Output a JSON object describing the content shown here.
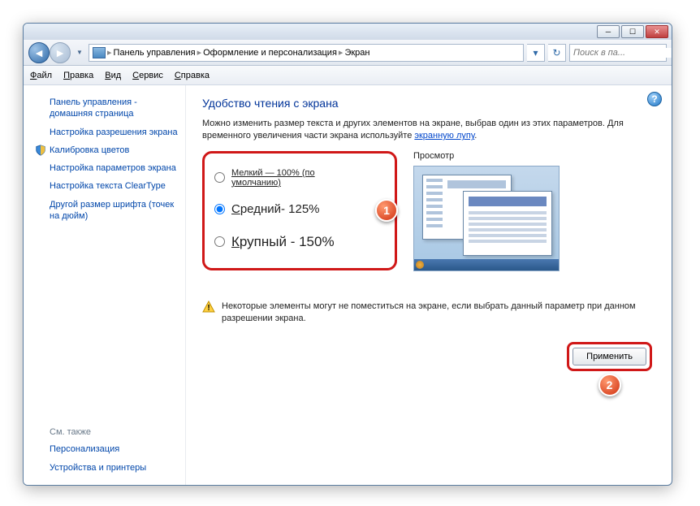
{
  "titlebar": {
    "min": "─",
    "max": "☐",
    "close": "✕"
  },
  "breadcrumb": {
    "root": "Панель управления",
    "mid": "Оформление и персонализация",
    "leaf": "Экран"
  },
  "search": {
    "placeholder": "Поиск в па..."
  },
  "menu": {
    "file": "Файл",
    "file_u": "Ф",
    "edit": "Правка",
    "edit_u": "П",
    "view": "Вид",
    "view_u": "В",
    "tools": "Сервис",
    "tools_u": "С",
    "help": "Справка",
    "help_u": "С"
  },
  "sidebar": {
    "home": "Панель управления - домашняя страница",
    "resolution": "Настройка разрешения экрана",
    "calibrate": "Калибровка цветов",
    "params": "Настройка параметров экрана",
    "cleartype": "Настройка текста ClearType",
    "dpi": "Другой размер шрифта (точек на дюйм)",
    "seealso": "См. также",
    "personalization": "Персонализация",
    "devices": "Устройства и принтеры"
  },
  "content": {
    "heading": "Удобство чтения с экрана",
    "desc1": "Можно изменить размер текста и других элементов на экране, выбрав один из этих параметров. Для временного увеличения части экрана используйте ",
    "magnifier_link": "экранную лупу",
    "preview_label": "Просмотр",
    "radio_small": "Мелкий — 100% (по умолчанию)",
    "radio_small_u": "М",
    "radio_medium_pre": "С",
    "radio_medium_rest": "редний- 125%",
    "radio_large_pre": "К",
    "radio_large_rest": "рупный - 150%",
    "warning": "Некоторые элементы могут не поместиться на экране, если выбрать данный параметр при данном разрешении экрана.",
    "apply": "Применить"
  },
  "callouts": {
    "one": "1",
    "two": "2"
  }
}
